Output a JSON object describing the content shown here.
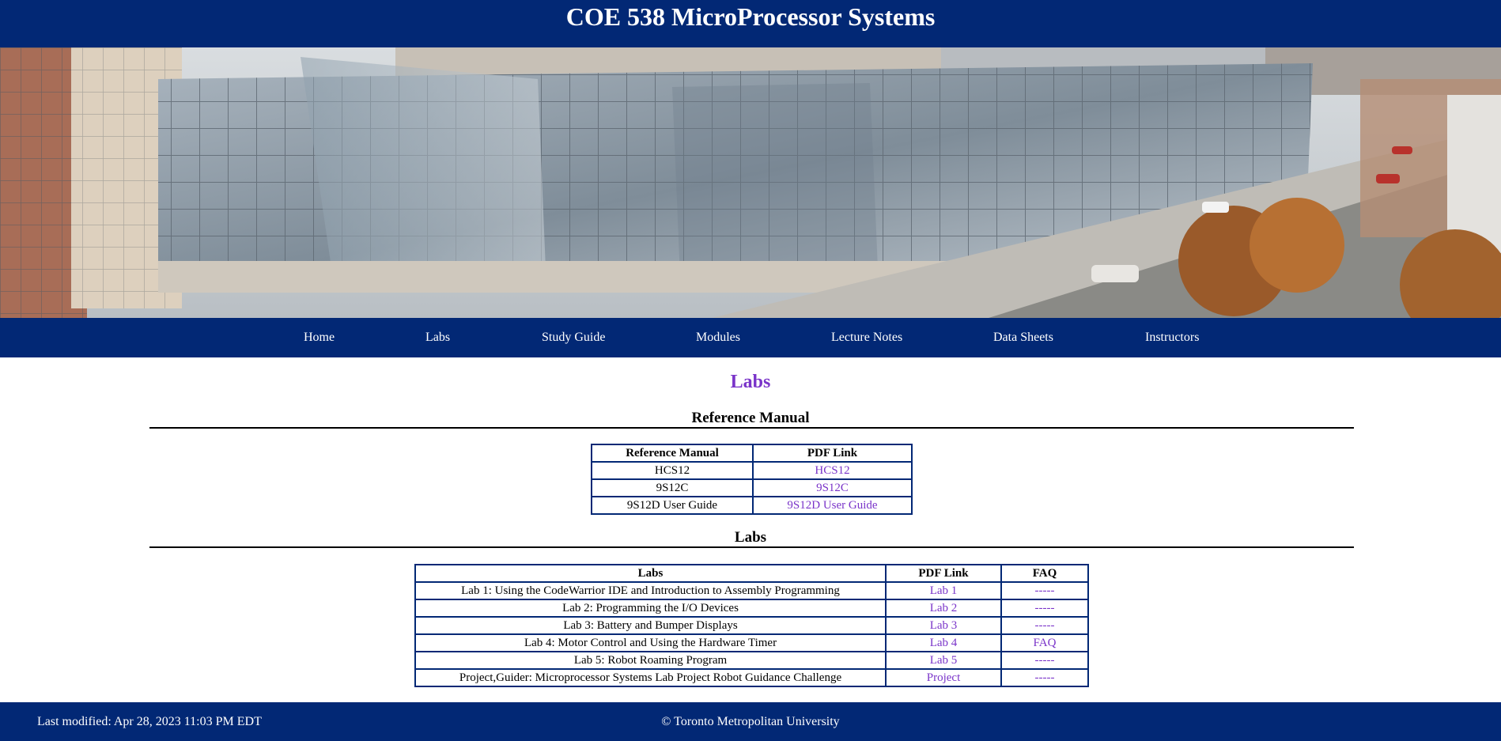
{
  "header": {
    "title": "COE 538 MicroProcessor Systems"
  },
  "nav": {
    "items": [
      {
        "label": "Home"
      },
      {
        "label": "Labs"
      },
      {
        "label": "Study Guide"
      },
      {
        "label": "Modules"
      },
      {
        "label": "Lecture Notes"
      },
      {
        "label": "Data Sheets"
      },
      {
        "label": "Instructors"
      }
    ]
  },
  "main": {
    "title": "Labs",
    "reference_section": {
      "heading": "Reference Manual",
      "columns": [
        "Reference Manual",
        "PDF Link"
      ],
      "rows": [
        {
          "name": "HCS12",
          "link": "HCS12"
        },
        {
          "name": "9S12C",
          "link": "9S12C"
        },
        {
          "name": "9S12D User Guide",
          "link": "9S12D User Guide"
        }
      ]
    },
    "labs_section": {
      "heading": "Labs",
      "columns": [
        "Labs",
        "PDF Link",
        "FAQ"
      ],
      "rows": [
        {
          "name": "Lab 1: Using the CodeWarrior IDE and Introduction to Assembly Programming",
          "link": "Lab 1",
          "faq": "-----"
        },
        {
          "name": "Lab 2: Programming the I/O Devices",
          "link": "Lab 2",
          "faq": "-----"
        },
        {
          "name": "Lab 3: Battery and Bumper Displays",
          "link": "Lab 3",
          "faq": "-----"
        },
        {
          "name": "Lab 4: Motor Control and Using the Hardware Timer",
          "link": "Lab 4",
          "faq": "FAQ"
        },
        {
          "name": "Lab 5: Robot Roaming Program",
          "link": "Lab 5",
          "faq": "-----"
        },
        {
          "name": "Project,Guider: Microprocessor Systems Lab Project Robot Guidance Challenge",
          "link": "Project",
          "faq": "-----"
        }
      ]
    }
  },
  "footer": {
    "last_modified": "Last modified: Apr 28, 2023 11:03 PM EDT",
    "copyright": "© Toronto Metropolitan University"
  },
  "colors": {
    "brand_blue": "#022875",
    "link_purple": "#7a34c9",
    "white": "#ffffff"
  }
}
